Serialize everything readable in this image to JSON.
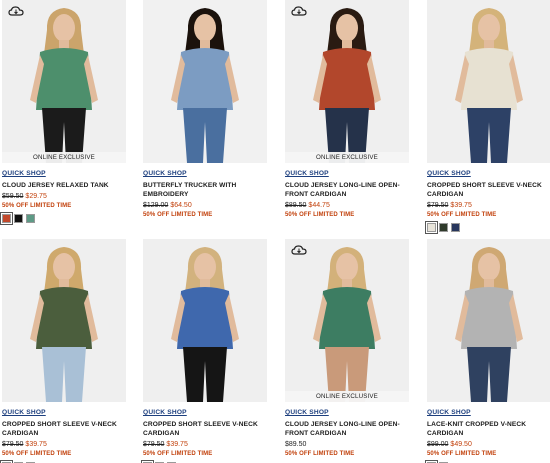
{
  "quick_shop_label": "QUICK SHOP",
  "products": [
    {
      "name": "CLOUD JERSEY RELAXED TANK",
      "orig": "$59.50",
      "sale": "$29.75",
      "promo": "50% OFF LIMITED TIME",
      "badge": "ONLINE EXCLUSIVE",
      "cloud": true,
      "swatches": [
        "#c2482b",
        "#111111",
        "#5e9a86"
      ],
      "bg": "#efefef",
      "top": "#4d8f6c",
      "bottom": "#1b1b1b",
      "hair": "#cba46b"
    },
    {
      "name": "BUTTERFLY TRUCKER WITH EMBROIDERY",
      "orig": "$129.00",
      "sale": "$64.50",
      "promo": "50% OFF LIMITED TIME",
      "badge": "",
      "cloud": false,
      "swatches": [],
      "bg": "#f1f1f1",
      "top": "#7c9cc2",
      "bottom": "#4a6f9f",
      "hair": "#1b120c"
    },
    {
      "name": "CLOUD JERSEY LONG-LINE OPEN-FRONT CARDIGAN",
      "orig": "$89.50",
      "sale": "$44.75",
      "promo": "50% OFF LIMITED TIME",
      "badge": "ONLINE EXCLUSIVE",
      "cloud": true,
      "swatches": [],
      "bg": "#efefef",
      "top": "#b2472c",
      "bottom": "#25324a",
      "hair": "#2a1b12"
    },
    {
      "name": "CROPPED SHORT SLEEVE V-NECK CARDIGAN",
      "orig": "$79.50",
      "sale": "$39.75",
      "promo": "50% OFF LIMITED TIME",
      "badge": "",
      "cloud": false,
      "swatches": [
        "#e8e4da",
        "#2f3a2b",
        "#27365c"
      ],
      "bg": "#efefef",
      "top": "#e7e1d2",
      "bottom": "#2d4166",
      "hair": "#d4b37a"
    },
    {
      "name": "CROPPED SHORT SLEEVE V-NECK CARDIGAN",
      "orig": "$79.50",
      "sale": "$39.75",
      "promo": "50% OFF LIMITED TIME",
      "badge": "",
      "cloud": false,
      "swatches": [
        "#e8e4da",
        "#2f3a2b",
        "#27365c"
      ],
      "bg": "#efefef",
      "top": "#4b5e3d",
      "bottom": "#a9c0d6",
      "hair": "#cfa96c"
    },
    {
      "name": "CROPPED SHORT SLEEVE V-NECK CARDIGAN",
      "orig": "$79.50",
      "sale": "$39.75",
      "promo": "50% OFF LIMITED TIME",
      "badge": "",
      "cloud": false,
      "swatches": [
        "#e8e4da",
        "#2f3a2b",
        "#27365c"
      ],
      "bg": "#efefef",
      "top": "#3f68ad",
      "bottom": "#151515",
      "hair": "#d2b27e"
    },
    {
      "name": "CLOUD JERSEY LONG-LINE OPEN-FRONT CARDIGAN",
      "full": "$89.50",
      "promo": "50% OFF LIMITED TIME",
      "badge": "ONLINE EXCLUSIVE",
      "cloud": true,
      "swatches": [],
      "bg": "#efefef",
      "top": "#3d7d62",
      "bottom": "#c99a7a",
      "hair": "#d3b17a"
    },
    {
      "name": "LACE-KNIT CROPPED V-NECK CARDIGAN",
      "orig": "$99.00",
      "sale": "$49.50",
      "promo": "50% OFF LIMITED TIME",
      "badge": "",
      "cloud": false,
      "swatches": [
        "#b5502c",
        "#c9c9c9"
      ],
      "bg": "#efefef",
      "top": "#b3b3b3",
      "bottom": "#2f4160",
      "hair": "#cfa873"
    }
  ]
}
